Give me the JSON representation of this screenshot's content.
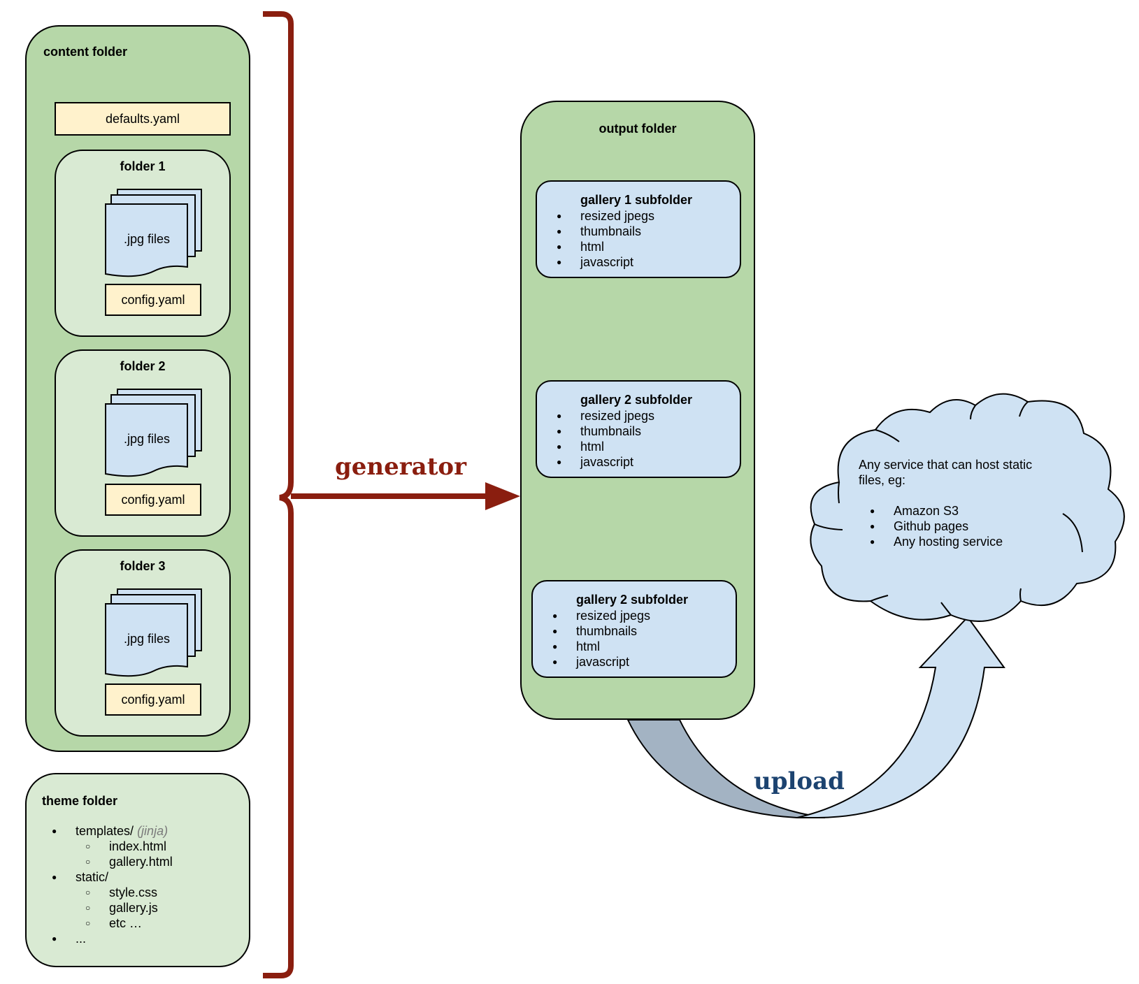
{
  "colors": {
    "folder_green": "#b6d7a8",
    "subfolder_green": "#d9ead3",
    "file_blue": "#cfe2f3",
    "yaml_yellow": "#fff2cc",
    "generator_red": "#8a1e0f",
    "upload_navy": "#1c4370",
    "upload_arrow_gray": "#a3b3c3"
  },
  "content_folder": {
    "title": "content folder",
    "defaults_file": "defaults.yaml",
    "folders": [
      {
        "title": "folder 1",
        "files_label": ".jpg files",
        "config_label": "config.yaml"
      },
      {
        "title": "folder 2",
        "files_label": ".jpg files",
        "config_label": "config.yaml"
      },
      {
        "title": "folder 3",
        "files_label": ".jpg files",
        "config_label": "config.yaml"
      }
    ]
  },
  "theme_folder": {
    "title": "theme folder",
    "items": [
      {
        "label": "templates/",
        "note": "(jinja)",
        "children": [
          "index.html",
          "gallery.html"
        ]
      },
      {
        "label": "static/",
        "children": [
          "style.css",
          "gallery.js",
          "etc …"
        ]
      },
      {
        "label": "..."
      }
    ]
  },
  "generator": {
    "label": "generator"
  },
  "output_folder": {
    "title": "output folder",
    "subfolders": [
      {
        "title": "gallery 1 subfolder",
        "items": [
          "resized jpegs",
          "thumbnails",
          "html",
          "javascript"
        ]
      },
      {
        "title": "gallery 2 subfolder",
        "items": [
          "resized jpegs",
          "thumbnails",
          "html",
          "javascript"
        ]
      },
      {
        "title": "gallery 2 subfolder",
        "items": [
          "resized jpegs",
          "thumbnails",
          "html",
          "javascript"
        ]
      }
    ]
  },
  "upload": {
    "label": "upload"
  },
  "cloud": {
    "description": "Any service that can host static files, eg:",
    "services": [
      "Amazon S3",
      "Github pages",
      "Any hosting service"
    ]
  }
}
